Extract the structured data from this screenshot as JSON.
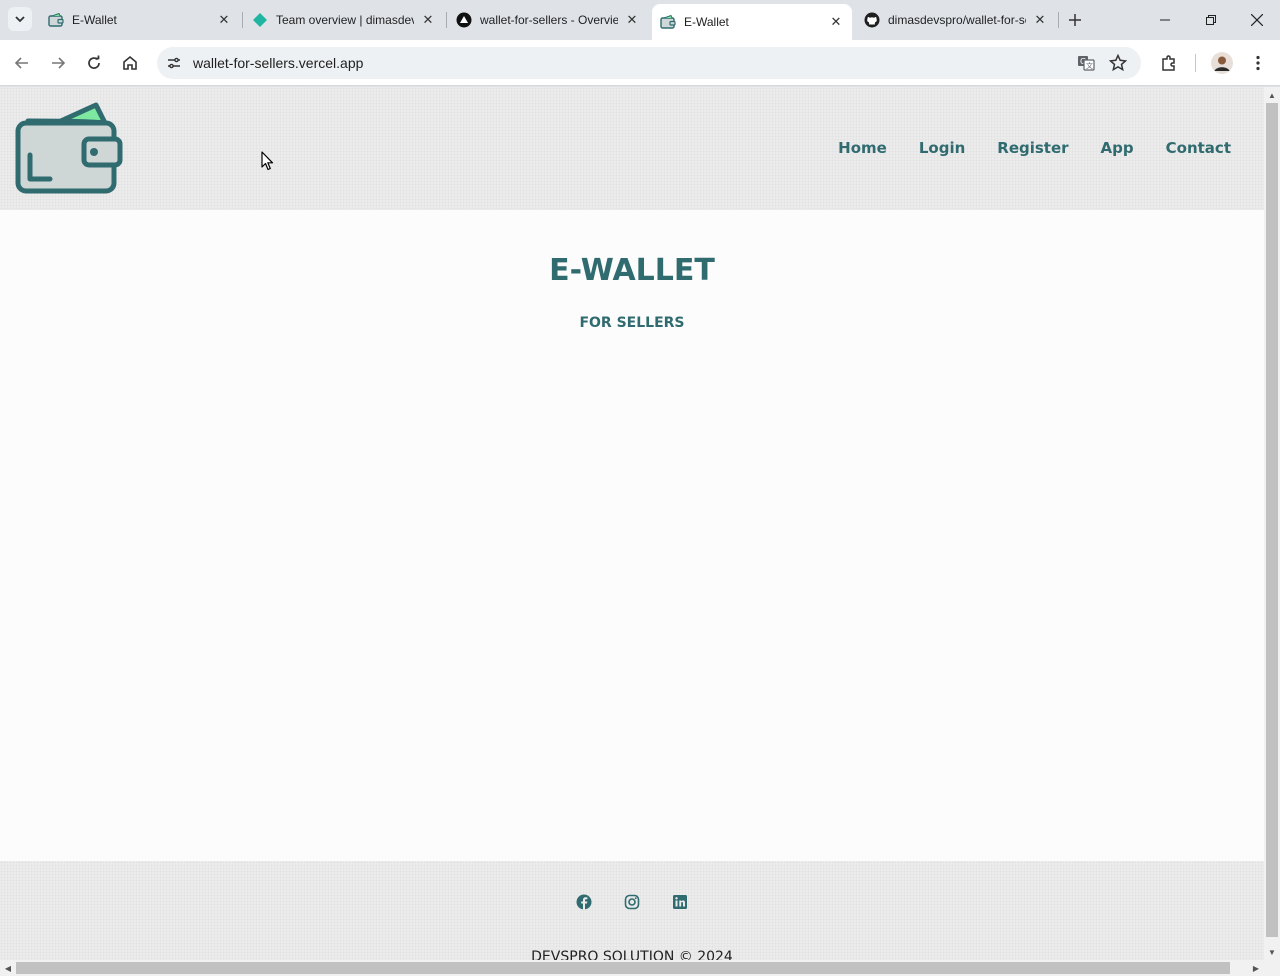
{
  "browser": {
    "tabs": [
      {
        "title": "E-Wallet",
        "favicon": "wallet-icon",
        "active": false
      },
      {
        "title": "Team overview | dimasdevspro",
        "favicon": "diamond-icon",
        "active": false
      },
      {
        "title": "wallet-for-sellers - Overview",
        "favicon": "vercel-icon",
        "active": false
      },
      {
        "title": "E-Wallet",
        "favicon": "wallet-icon",
        "active": true
      },
      {
        "title": "dimasdevspro/wallet-for-sellers",
        "favicon": "github-icon",
        "active": false
      }
    ],
    "address_bar": {
      "url": "wallet-for-sellers.vercel.app"
    }
  },
  "site": {
    "nav": [
      "Home",
      "Login",
      "Register",
      "App",
      "Contact"
    ],
    "hero": {
      "title": "E-WALLET",
      "subtitle": "FOR SELLERS"
    },
    "footer": {
      "social": [
        "facebook-icon",
        "instagram-icon",
        "linkedin-icon"
      ],
      "copyright": "DEVSPRO SOLUTION © 2024"
    }
  },
  "colors": {
    "brand": "#2f6b6f",
    "accent": "#7ee8a0"
  }
}
